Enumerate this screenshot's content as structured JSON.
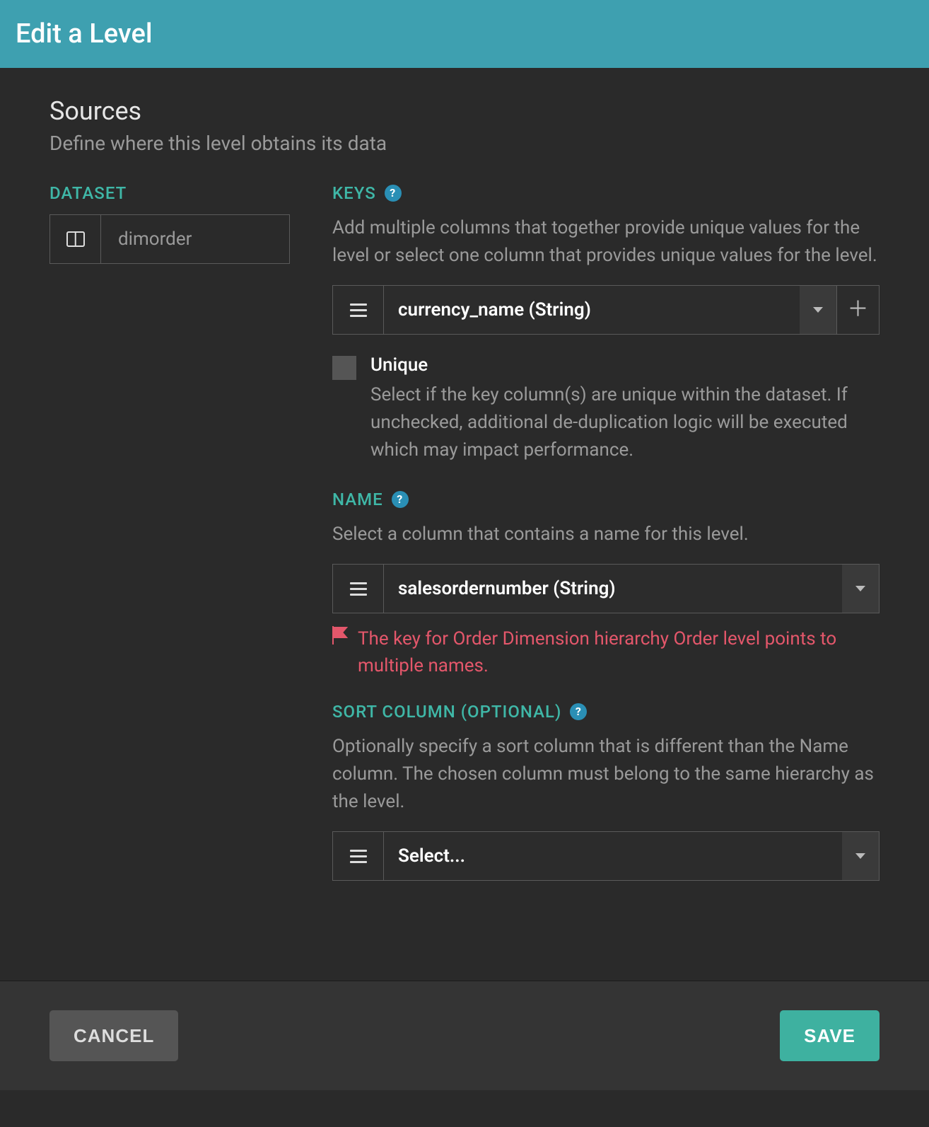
{
  "header": {
    "title": "Edit a Level"
  },
  "section": {
    "title": "Sources",
    "subtitle": "Define where this level obtains its data"
  },
  "dataset": {
    "label": "DATASET",
    "value": "dimorder"
  },
  "keys": {
    "label": "KEYS",
    "desc": "Add multiple columns that together provide unique values for the level or select one column that provides unique values for the level.",
    "selected": "currency_name (String)",
    "unique": {
      "title": "Unique",
      "desc": "Select if the key column(s) are unique within the dataset. If unchecked, additional de-duplication logic will be executed which may impact performance.",
      "checked": false
    }
  },
  "name": {
    "label": "NAME",
    "desc": "Select a column that contains a name for this level.",
    "selected": "salesordernumber (String)",
    "error": "The key for Order Dimension hierarchy Order level points to multiple names."
  },
  "sort": {
    "label": "SORT COLUMN (OPTIONAL)",
    "desc": "Optionally specify a sort column that is different than the Name column. The chosen column must belong to the same hierarchy as the level.",
    "placeholder": "Select..."
  },
  "footer": {
    "cancel": "CANCEL",
    "save": "SAVE"
  }
}
